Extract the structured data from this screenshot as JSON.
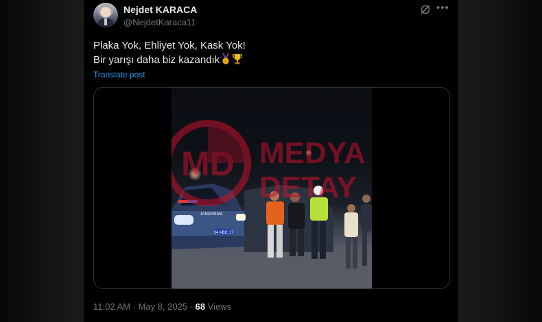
{
  "author": {
    "name": "Nejdet KARACA",
    "handle": "@NejdetKaraca11"
  },
  "post": {
    "line1": "Plaka Yok, Ehliyet Yok, Kask Yok!",
    "line2": "Bir yarışı daha biz kazandık",
    "emojis": [
      "medal-icon",
      "trophy-icon"
    ],
    "translate_label": "Translate post"
  },
  "media": {
    "type": "video",
    "watermark": {
      "logo": "MD",
      "line1": "MEDYA",
      "line2": "DETAY"
    },
    "plate": "34 ABC 17",
    "vehicle_label": "JANDARMA"
  },
  "meta": {
    "time": "11:02 AM",
    "date": "May 8, 2025",
    "views": "68",
    "views_label": "Views"
  },
  "colors": {
    "link": "#1d9bf0",
    "muted": "#71767b",
    "text": "#e7e9ea",
    "watermark": "#c8102e"
  }
}
